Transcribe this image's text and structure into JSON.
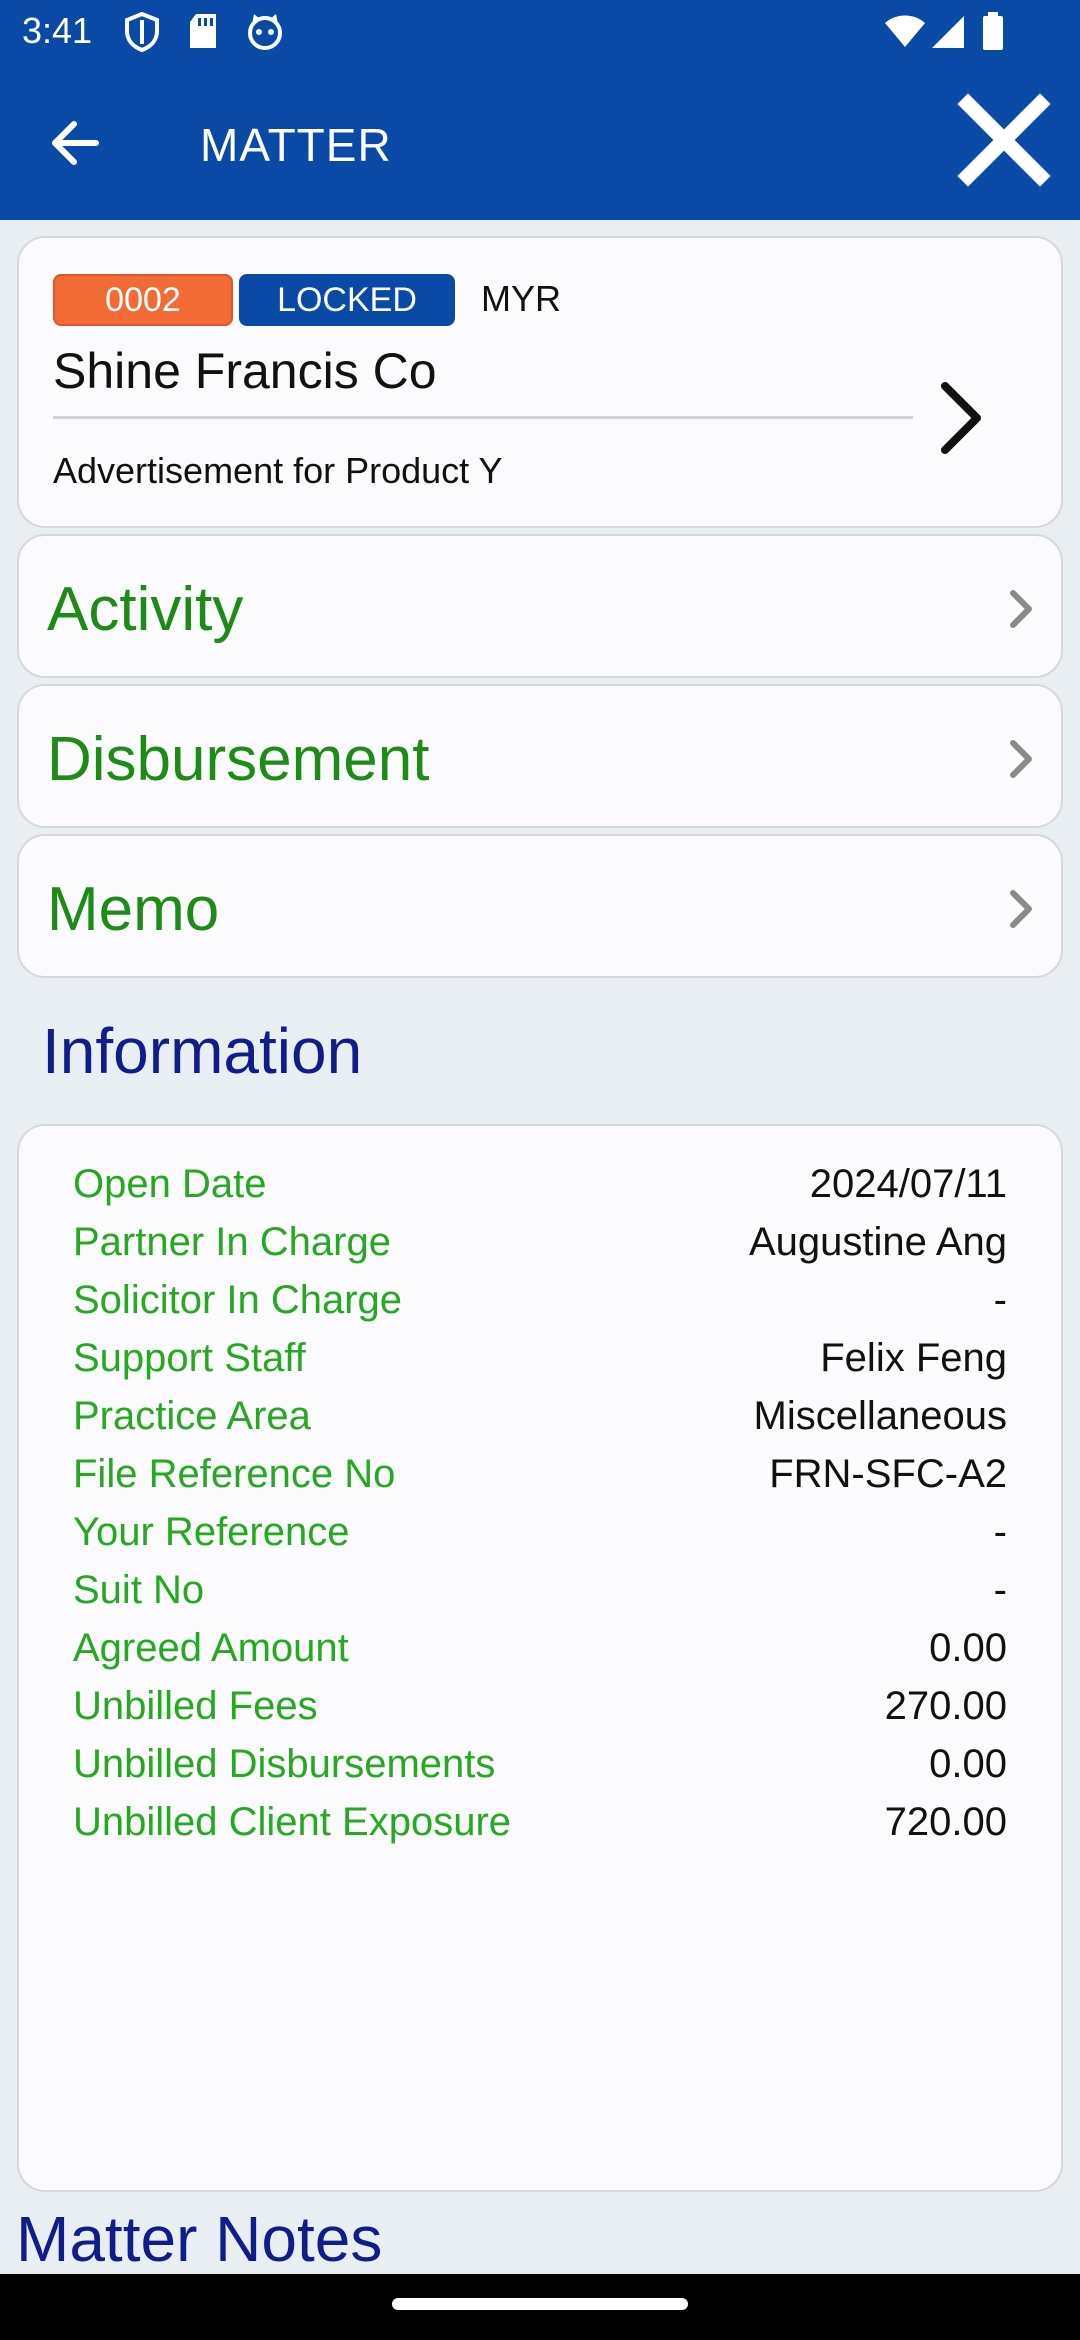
{
  "status_bar": {
    "time": "3:41",
    "icons": [
      "shield-icon",
      "sd-card-icon",
      "cat-face-icon"
    ],
    "right_icons": [
      "wifi-icon",
      "cell-signal-icon",
      "battery-icon"
    ]
  },
  "app_bar": {
    "title": "MATTER",
    "back_icon": "arrow-left-icon",
    "close_icon": "close-icon"
  },
  "matter": {
    "code": "0002",
    "status": "LOCKED",
    "currency": "MYR",
    "client": "Shine Francis Co",
    "description": "Advertisement for Product Y"
  },
  "nav": {
    "activity": "Activity",
    "disbursement": "Disbursement",
    "memo": "Memo"
  },
  "information": {
    "title": "Information",
    "rows": [
      {
        "label": "Open Date",
        "value": "2024/07/11"
      },
      {
        "label": "Partner In Charge",
        "value": "Augustine Ang"
      },
      {
        "label": "Solicitor In Charge",
        "value": "-"
      },
      {
        "label": "Support Staff",
        "value": "Felix Feng"
      },
      {
        "label": "Practice Area",
        "value": "Miscellaneous"
      },
      {
        "label": "File Reference No",
        "value": "FRN-SFC-A2"
      },
      {
        "label": "Your Reference",
        "value": "-"
      },
      {
        "label": "Suit No",
        "value": "-"
      },
      {
        "label": "Agreed Amount",
        "value": "0.00"
      },
      {
        "label": "Unbilled Fees",
        "value": "270.00"
      },
      {
        "label": "Unbilled Disbursements",
        "value": "0.00"
      },
      {
        "label": "Unbilled Client Exposure",
        "value": "720.00"
      }
    ]
  },
  "matter_notes": {
    "title": "Matter Notes"
  },
  "colors": {
    "primary": "#0a4aa6",
    "accent_green": "#1e8a18",
    "label_green": "#27a823",
    "heading_navy": "#101c8a",
    "code_badge": "#f26b36"
  }
}
